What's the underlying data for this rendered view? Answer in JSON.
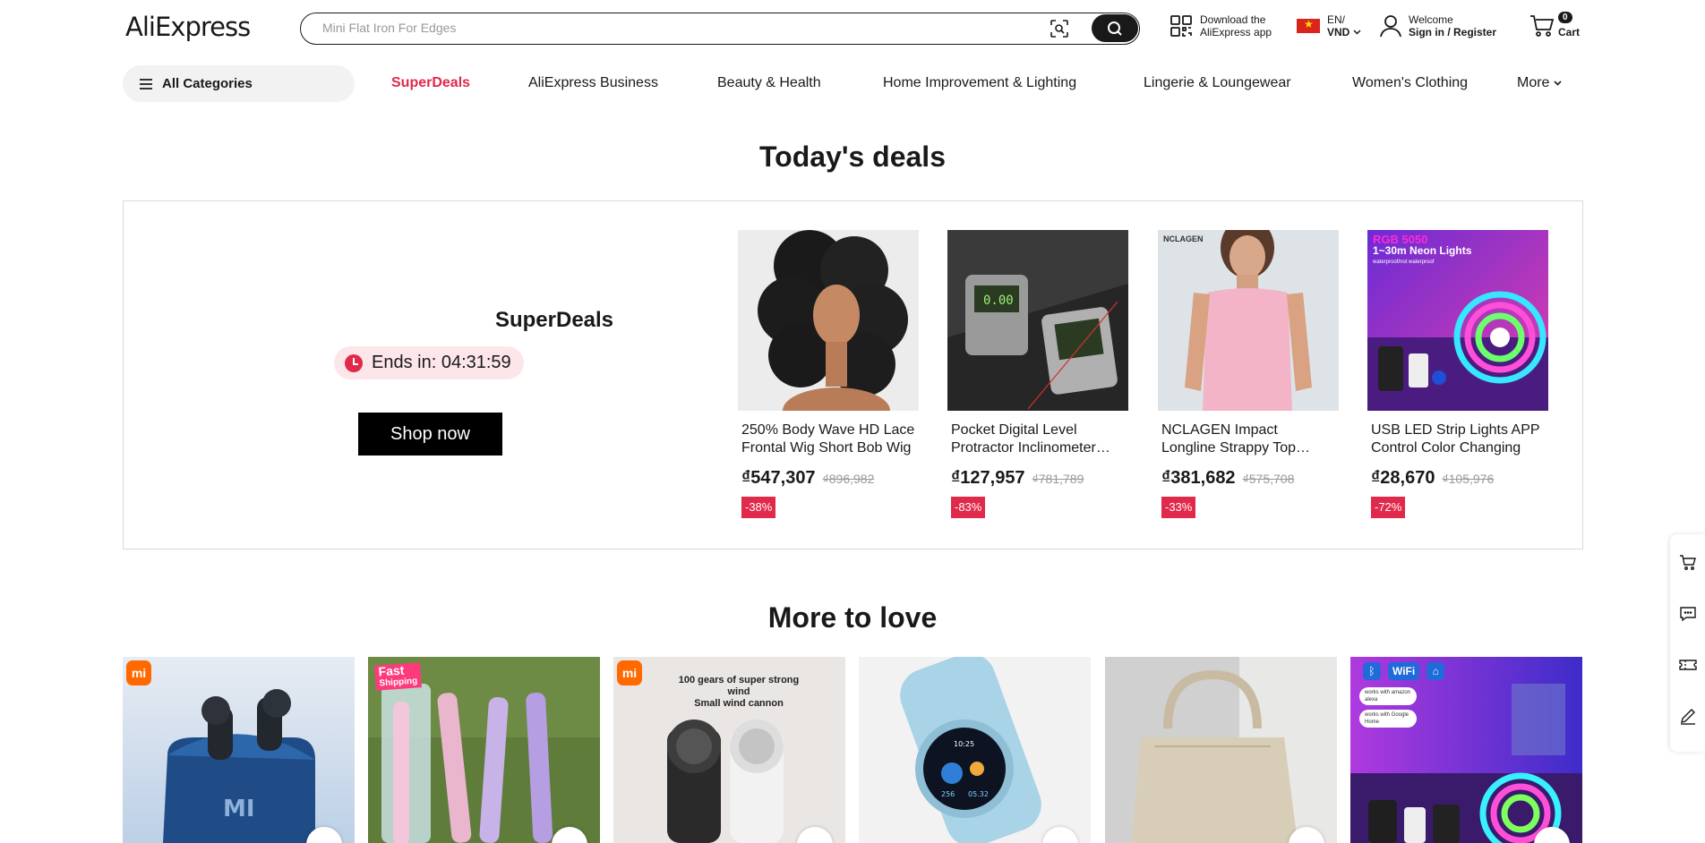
{
  "header": {
    "logo": "AliExpress",
    "search_placeholder": "Mini Flat Iron For Edges",
    "download_line1": "Download the",
    "download_line2": "AliExpress app",
    "lang_line1": "EN/",
    "lang_line2": "VND",
    "welcome_line1": "Welcome",
    "welcome_line2": "Sign in / Register",
    "cart_count": "0",
    "cart_label": "Cart"
  },
  "nav": {
    "all_categories": "All Categories",
    "links": [
      "SuperDeals",
      "AliExpress Business",
      "Beauty & Health",
      "Home Improvement & Lighting",
      "Lingerie & Loungewear",
      "Women's Clothing"
    ],
    "more": "More"
  },
  "deals": {
    "section_title": "Today's deals",
    "superdeals_title": "SuperDeals",
    "timer": "Ends in: 04:31:59",
    "shop_now": "Shop now",
    "items": [
      {
        "name": "250% Body Wave HD Lace Frontal Wig Short Bob Wig",
        "price": "₫547,307",
        "old_price": "₫896,982",
        "discount": "-38%"
      },
      {
        "name": "Pocket Digital Level Protractor Inclinometer Angle",
        "price": "₫127,957",
        "old_price": "₫781,789",
        "discount": "-83%"
      },
      {
        "name": "NCLAGEN Impact Longline Strappy Top Sports",
        "price": "₫381,682",
        "old_price": "₫575,708",
        "discount": "-33%"
      },
      {
        "name": "USB LED Strip Lights APP Control Color Changing",
        "price": "₫28,670",
        "old_price": "₫105,976",
        "discount": "-72%"
      }
    ],
    "img_text": {
      "nclagen": "NCLAGEN",
      "rgb_line1": "RGB 5050",
      "rgb_line2": "1~30m Neon Lights",
      "rgb_line3": "waterproof/not waterproof"
    }
  },
  "love": {
    "section_title": "More to love",
    "img_text": {
      "mi": "MI",
      "mi_logo": "mi",
      "fast_line1": "Fast",
      "fast_line2": "Shipping",
      "fan_line1": "100 gears of super strong",
      "fan_line2": "wind",
      "fan_line3": "Small wind cannon",
      "watch_time": "10:25",
      "watch_val1": "256",
      "watch_val2": "05.32",
      "led_label1": "works with amazon alexa",
      "led_label2": "works with Google Home",
      "wifi": "WiFi"
    }
  },
  "colors": {
    "accent": "#e0294b",
    "dark": "#191919",
    "muted": "#999999"
  }
}
